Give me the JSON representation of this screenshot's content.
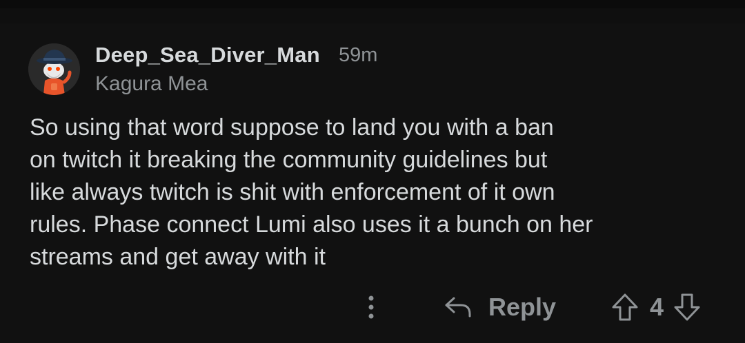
{
  "comment": {
    "author": "Deep_Sea_Diver_Man",
    "time": "59m",
    "flair": "Kagura Mea",
    "body_lines": [
      "So using that word suppose to land you with a ban",
      "on twitch it breaking the community guidelines but",
      "like always twitch is shit with enforcement of it own",
      "rules. Phase connect Lumi also uses it a bunch on her",
      "streams and get away with it"
    ],
    "avatar_icon": "snoo-avatar-icon"
  },
  "actions": {
    "more_icon": "more-vertical-icon",
    "reply_icon": "reply-arrow-icon",
    "reply_label": "Reply",
    "upvote_icon": "upvote-arrow-icon",
    "vote_count": "4",
    "downvote_icon": "downvote-arrow-icon"
  },
  "colors": {
    "background": "#111111",
    "text_primary": "#d7dadc",
    "text_secondary": "#8f9396"
  }
}
